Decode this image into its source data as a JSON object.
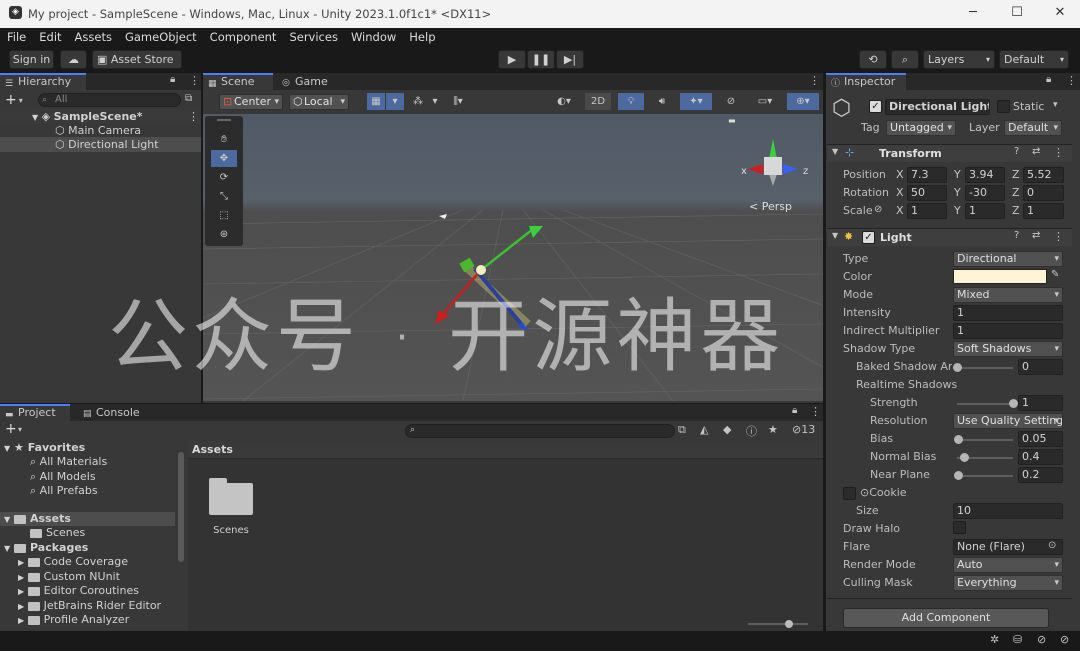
{
  "window": {
    "title": "My project - SampleScene - Windows, Mac, Linux - Unity 2023.1.0f1c1* <DX11>"
  },
  "menu": [
    "File",
    "Edit",
    "Assets",
    "GameObject",
    "Component",
    "Services",
    "Window",
    "Help"
  ],
  "toolbar": {
    "sign_in": "Sign in",
    "asset_store": "Asset Store",
    "layers": "Layers",
    "layout": "Default"
  },
  "hierarchy": {
    "tab": "Hierarchy",
    "search_placeholder": "All",
    "scene": "SampleScene*",
    "items": [
      "Main Camera",
      "Directional Light"
    ]
  },
  "scene_tabs": {
    "scene": "Scene",
    "game": "Game"
  },
  "scene_toolbar": {
    "pivot": "Center",
    "space": "Local",
    "mode_2d": "2D"
  },
  "scene_view": {
    "persp_label": "Persp",
    "axis_x": "x",
    "axis_z": "z"
  },
  "project": {
    "tabs": [
      "Project",
      "Console"
    ],
    "hidden_count": "13",
    "breadcrumb": "Assets",
    "favorites_label": "Favorites",
    "favorites": [
      "All Materials",
      "All Models",
      "All Prefabs"
    ],
    "assets_label": "Assets",
    "assets_children": [
      "Scenes"
    ],
    "packages_label": "Packages",
    "packages": [
      "Code Coverage",
      "Custom NUnit",
      "Editor Coroutines",
      "JetBrains Rider Editor",
      "Profile Analyzer"
    ],
    "grid_items": [
      "Scenes"
    ]
  },
  "inspector": {
    "tab": "Inspector",
    "object_name": "Directional Light",
    "static_label": "Static",
    "tag_label": "Tag",
    "tag_value": "Untagged",
    "layer_label": "Layer",
    "layer_value": "Default",
    "transform": {
      "title": "Transform",
      "position_label": "Position",
      "rotation_label": "Rotation",
      "scale_label": "Scale",
      "axes": [
        "X",
        "Y",
        "Z"
      ],
      "position": [
        "7.3",
        "3.94",
        "5.52"
      ],
      "rotation": [
        "50",
        "-30",
        "0"
      ],
      "scale": [
        "1",
        "1",
        "1"
      ]
    },
    "light": {
      "title": "Light",
      "type_label": "Type",
      "type_value": "Directional",
      "color_label": "Color",
      "color_value": "#fff4d6",
      "mode_label": "Mode",
      "mode_value": "Mixed",
      "intensity_label": "Intensity",
      "intensity_value": "1",
      "indirect_label": "Indirect Multiplier",
      "indirect_value": "1",
      "shadow_type_label": "Shadow Type",
      "shadow_type_value": "Soft Shadows",
      "baked_angle_label": "Baked Shadow Angle",
      "baked_angle_value": "0",
      "baked_angle_fraction": 0.0,
      "realtime_label": "Realtime Shadows",
      "strength_label": "Strength",
      "strength_value": "1",
      "strength_fraction": 1.0,
      "resolution_label": "Resolution",
      "resolution_value": "Use Quality Settings",
      "bias_label": "Bias",
      "bias_value": "0.05",
      "bias_fraction": 0.025,
      "normal_bias_label": "Normal Bias",
      "normal_bias_value": "0.4",
      "normal_bias_fraction": 0.13,
      "near_plane_label": "Near Plane",
      "near_plane_value": "0.2",
      "near_plane_fraction": 0.02,
      "cookie_label": "Cookie",
      "size_label": "Size",
      "size_value": "10",
      "draw_halo_label": "Draw Halo",
      "flare_label": "Flare",
      "flare_value": "None (Flare)",
      "render_mode_label": "Render Mode",
      "render_mode_value": "Auto",
      "culling_mask_label": "Culling Mask",
      "culling_mask_value": "Everything"
    },
    "add_component": "Add Component"
  },
  "watermark": "公众号 · 开源神器",
  "colors": {
    "accent": "#4c7fff",
    "panel": "#383838",
    "background": "#191919"
  }
}
